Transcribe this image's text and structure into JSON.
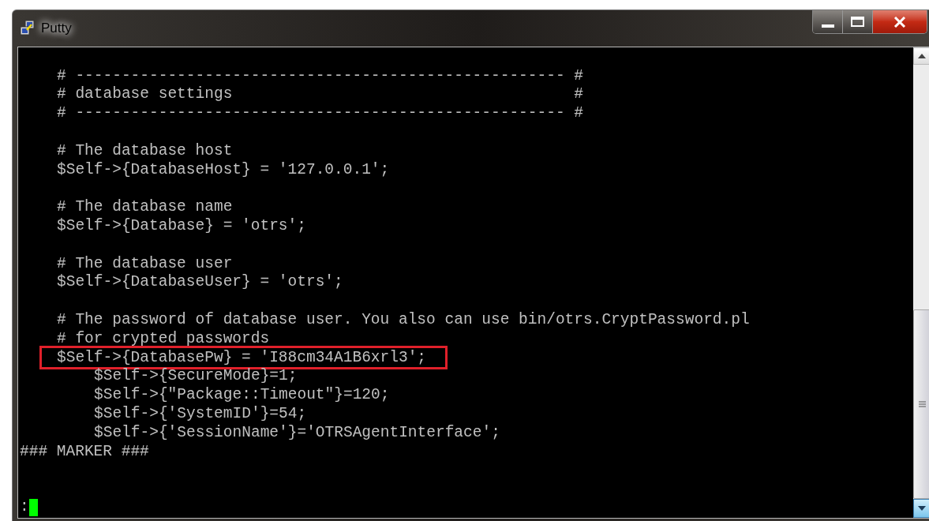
{
  "window": {
    "title": "Putty"
  },
  "terminal": {
    "lines": [
      {
        "kind": "blank"
      },
      {
        "kind": "config",
        "text": "# ----------------------------------------------------- #",
        "highlighted": false
      },
      {
        "kind": "config",
        "text": "# database settings                                     #",
        "highlighted": false
      },
      {
        "kind": "config",
        "text": "# ----------------------------------------------------- #",
        "highlighted": false
      },
      {
        "kind": "blank"
      },
      {
        "kind": "config",
        "text": "# The database host",
        "highlighted": false
      },
      {
        "kind": "config",
        "text": "$Self->{DatabaseHost} = '127.0.0.1';",
        "highlighted": false
      },
      {
        "kind": "blank"
      },
      {
        "kind": "config",
        "text": "# The database name",
        "highlighted": false
      },
      {
        "kind": "config",
        "text": "$Self->{Database} = 'otrs';",
        "highlighted": false
      },
      {
        "kind": "blank"
      },
      {
        "kind": "config",
        "text": "# The database user",
        "highlighted": false
      },
      {
        "kind": "config",
        "text": "$Self->{DatabaseUser} = 'otrs';",
        "highlighted": false
      },
      {
        "kind": "blank"
      },
      {
        "kind": "config",
        "text": "# The password of database user. You also can use bin/otrs.CryptPassword.pl",
        "highlighted": false
      },
      {
        "kind": "config",
        "text": "# for crypted passwords",
        "highlighted": false
      },
      {
        "kind": "config",
        "text": "$Self->{DatabasePw} = 'I88cm34A1B6xrl3';",
        "highlighted": true
      },
      {
        "kind": "nested",
        "text": "$Self->{SecureMode}=1;",
        "highlighted": false
      },
      {
        "kind": "nested",
        "text": "$Self->{\"Package::Timeout\"}=120;",
        "highlighted": false
      },
      {
        "kind": "nested",
        "text": "$Self->{'SystemID'}=54;",
        "highlighted": false
      },
      {
        "kind": "nested",
        "text": "$Self->{'SessionName'}='OTRSAgentInterface';",
        "highlighted": false
      },
      {
        "kind": "plain",
        "text": "### MARKER ###",
        "highlighted": false
      },
      {
        "kind": "blank"
      },
      {
        "kind": "blank"
      },
      {
        "kind": "prompt",
        "text": ":"
      }
    ]
  }
}
